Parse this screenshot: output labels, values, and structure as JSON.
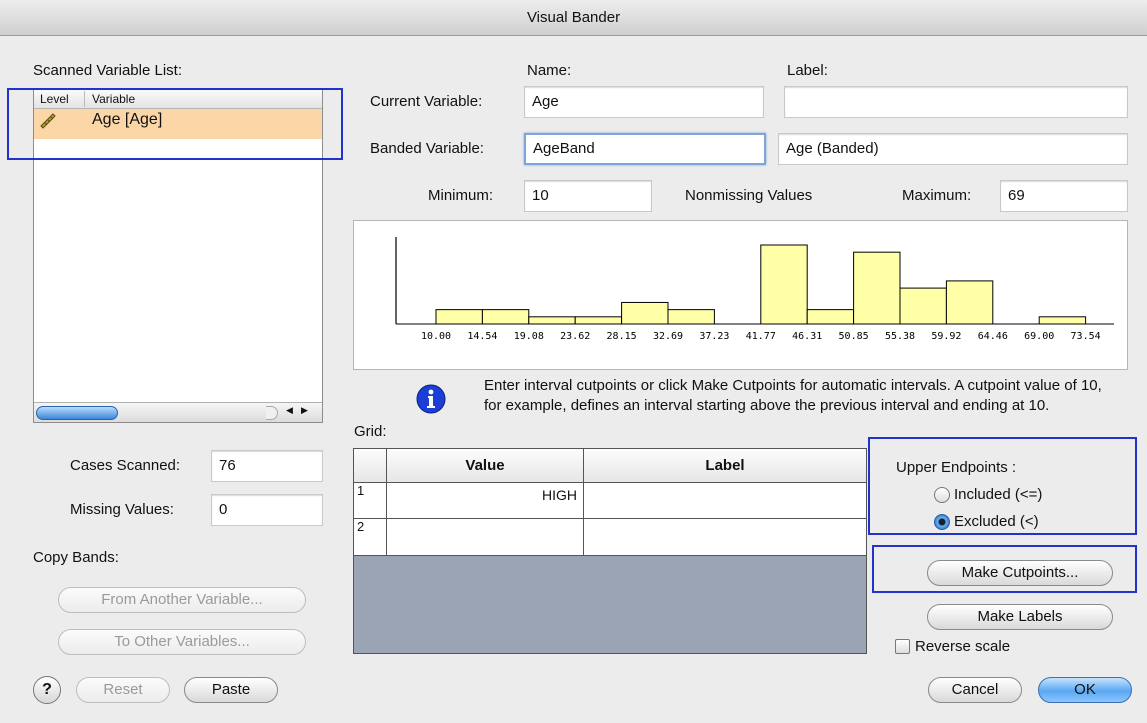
{
  "window": {
    "title": "Visual Bander"
  },
  "scanned_list": {
    "title": "Scanned Variable List:",
    "col_level": "Level",
    "col_variable": "Variable",
    "items": [
      {
        "icon": "scale-ruler-icon",
        "label": "Age [Age]"
      }
    ]
  },
  "header": {
    "name_col": "Name:",
    "label_col": "Label:"
  },
  "current_variable": {
    "label": "Current Variable:",
    "name": "Age",
    "var_label": ""
  },
  "banded_variable": {
    "label": "Banded Variable:",
    "name": "AgeBand",
    "var_label": "Age (Banded)"
  },
  "stats": {
    "minimum_label": "Minimum:",
    "minimum": "10",
    "nonmissing_label": "Nonmissing Values",
    "maximum_label": "Maximum:",
    "maximum": "69",
    "cases_label": "Cases Scanned:",
    "cases": "76",
    "missing_label": "Missing Values:",
    "missing": "0"
  },
  "chart_data": {
    "type": "bar",
    "tick_labels": [
      "10.00",
      "14.54",
      "19.08",
      "23.62",
      "28.15",
      "32.69",
      "37.23",
      "41.77",
      "46.31",
      "50.85",
      "55.38",
      "59.92",
      "64.46",
      "69.00",
      "73.54"
    ],
    "values": [
      2,
      2,
      1,
      1,
      3,
      2,
      0,
      11,
      2,
      10,
      5,
      6,
      0,
      1
    ],
    "ylim": [
      0,
      11
    ],
    "bar_color": "#ffffa8"
  },
  "info": {
    "icon": "info-icon",
    "text": "Enter interval cutpoints or click Make Cutpoints for automatic intervals. A cutpoint value of 10, for example, defines an interval starting above the previous interval and ending at 10."
  },
  "grid": {
    "title": "Grid:",
    "col_value": "Value",
    "col_label": "Label",
    "rows": [
      {
        "num": "1",
        "value": "HIGH",
        "label": ""
      },
      {
        "num": "2",
        "value": "",
        "label": ""
      }
    ]
  },
  "endpoints": {
    "title": "Upper Endpoints :",
    "included": "Included (<=)",
    "excluded": "Excluded (<)",
    "selected": "excluded"
  },
  "copy_bands": {
    "title": "Copy Bands:",
    "from": "From Another Variable...",
    "to": "To Other Variables..."
  },
  "buttons": {
    "make_cutpoints": "Make Cutpoints...",
    "make_labels": "Make Labels",
    "reverse_scale": "Reverse scale",
    "help": "?",
    "reset": "Reset",
    "paste": "Paste",
    "cancel": "Cancel",
    "ok": "OK"
  }
}
